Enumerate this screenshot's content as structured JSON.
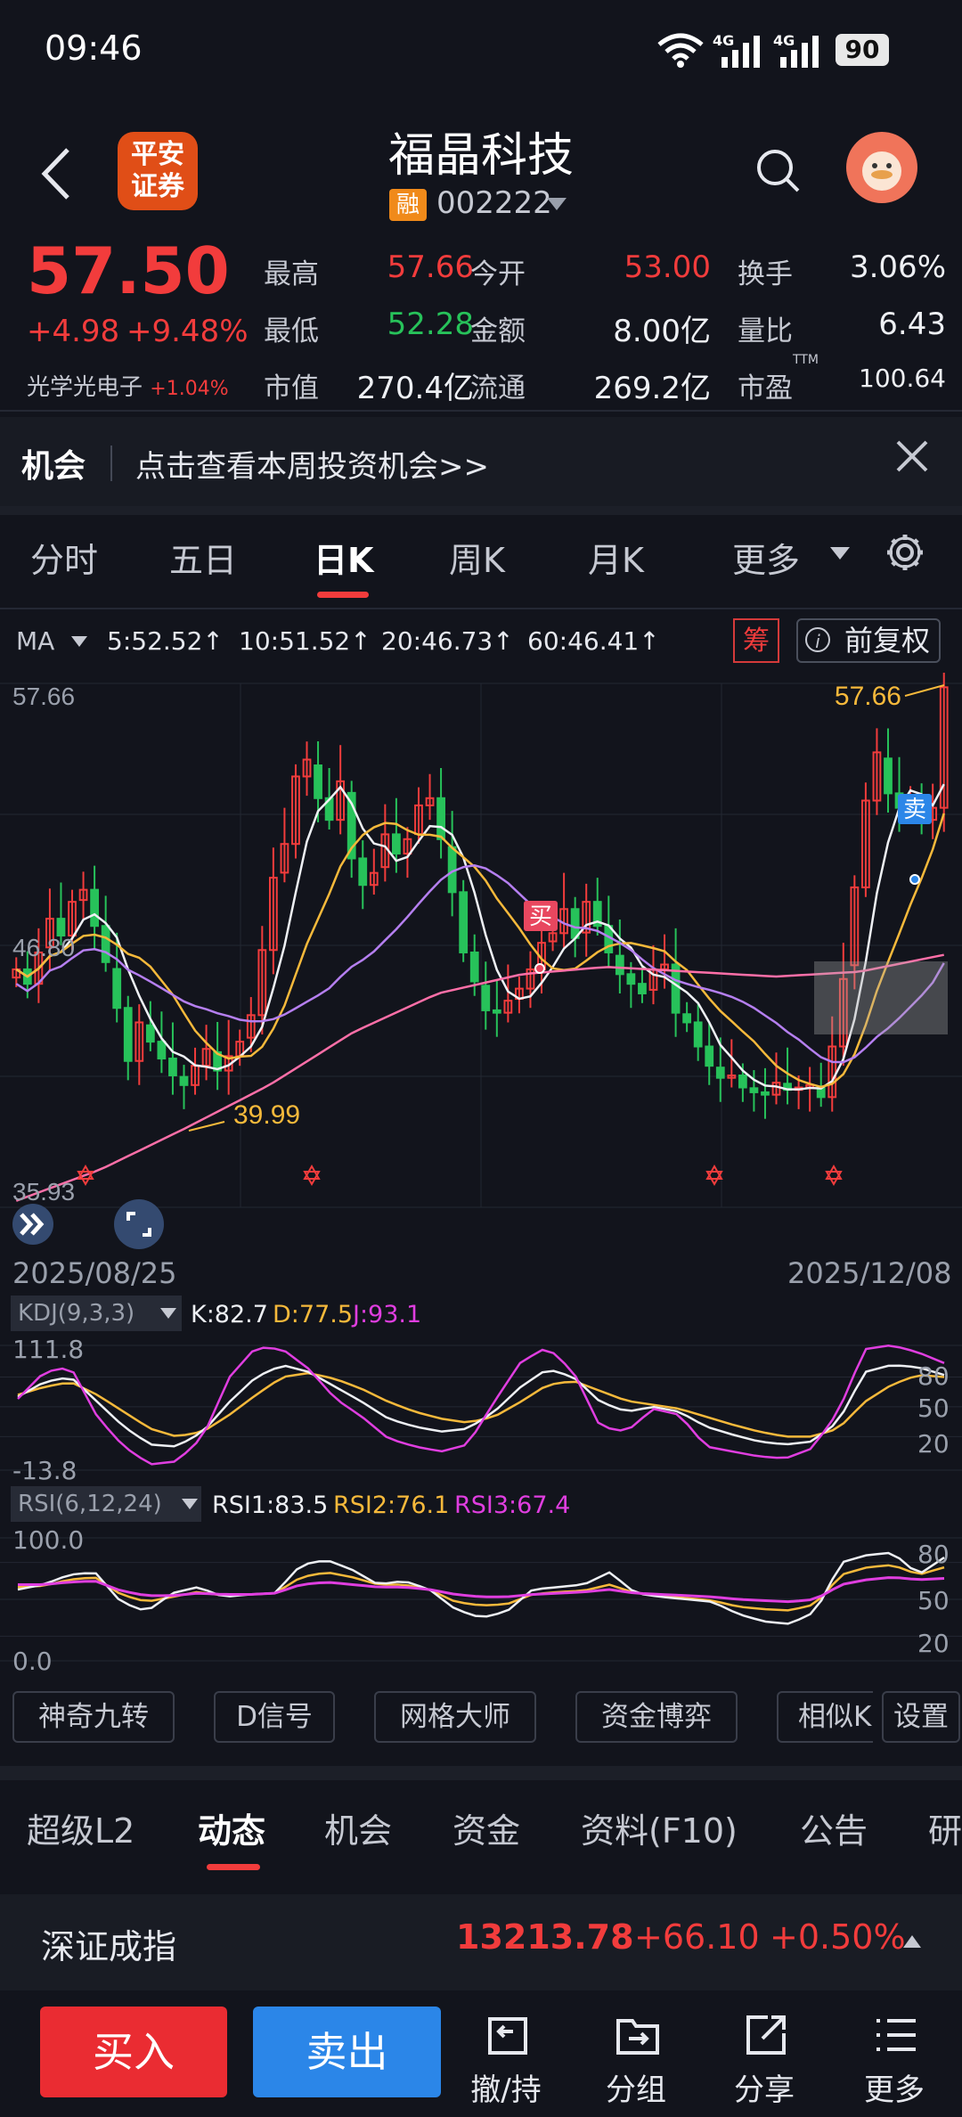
{
  "status_bar": {
    "time": "09:46",
    "network1": "4G",
    "network2": "4G",
    "battery": "90"
  },
  "header": {
    "broker_logo": "平安\n证券",
    "stock_name": "福晶科技",
    "financing_badge": "融",
    "stock_code": "002222"
  },
  "quote": {
    "price": "57.50",
    "change": "+4.98",
    "change_pct": "+9.48%",
    "sector_name": "光学光电子",
    "sector_pct": "+1.04%",
    "fields": [
      {
        "label": "最高",
        "value": "57.66",
        "color": "#f23c3c"
      },
      {
        "label": "今开",
        "value": "53.00",
        "color": "#f23c3c"
      },
      {
        "label": "换手",
        "value": "3.06%",
        "color": "#eef0f4"
      },
      {
        "label": "最低",
        "value": "52.28",
        "color": "#27c25a"
      },
      {
        "label": "金额",
        "value": "8.00亿",
        "color": "#eef0f4"
      },
      {
        "label": "量比",
        "value": "6.43",
        "color": "#eef0f4"
      },
      {
        "label": "市值",
        "value": "270.4亿",
        "color": "#eef0f4"
      },
      {
        "label": "流通",
        "value": "269.2亿",
        "color": "#eef0f4"
      },
      {
        "label": "市盈",
        "value": "100.64",
        "color": "#eef0f4"
      }
    ],
    "pe_suffix": "TTM"
  },
  "opportunity": {
    "title": "机会",
    "text": "点击查看本周投资机会>>"
  },
  "period_tabs": [
    "分时",
    "五日",
    "日K",
    "周K",
    "月K",
    "更多"
  ],
  "active_period": "日K",
  "ma_bar": {
    "label": "MA",
    "items": [
      {
        "text": "5:52.52↑",
        "color": "#eef0f4"
      },
      {
        "text": "10:51.52↑",
        "color": "#f6b93b"
      },
      {
        "text": "20:46.73↑",
        "color": "#b57ff0"
      },
      {
        "text": "60:46.41↑",
        "color": "#ff6fa8"
      }
    ],
    "chou_badge": "筹",
    "fuquan": "前复权"
  },
  "kline": {
    "y_max_label": "57.66",
    "y_mid_label": "46.80",
    "y_min_label": "35.93",
    "high_marker": "57.66",
    "low_marker": "39.99",
    "buy_marker": "买",
    "sell_marker": "卖",
    "start_date": "2025/08/25",
    "end_date": "2025/12/08",
    "y_range": [
      35.93,
      57.66
    ],
    "colors": {
      "up": "#f23c3c",
      "down": "#27c25a",
      "ma5": "#eef0f4",
      "ma10": "#f6b93b",
      "ma20": "#b57ff0",
      "ma60": "#ff6fa8"
    }
  },
  "kdj": {
    "box_label": "KDJ(9,3,3)",
    "k_text": "K:82.7",
    "d_text": "D:77.5",
    "j_text": "J:93.1",
    "y_top": "111.8",
    "y_bottom": "-13.8",
    "levels": [
      "80",
      "50",
      "20"
    ],
    "colors": {
      "k": "#eef0f4",
      "d": "#f6b93b",
      "j": "#e03ee0"
    }
  },
  "rsi": {
    "box_label": "RSI(6,12,24)",
    "rsi1_text": "RSI1:83.5",
    "rsi2_text": "RSI2:76.1",
    "rsi3_text": "RSI3:67.4",
    "y_top": "100.0",
    "y_bottom": "0.0",
    "levels": [
      "80",
      "50",
      "20"
    ],
    "colors": {
      "rsi1": "#eef0f4",
      "rsi2": "#f6b93b",
      "rsi3": "#e03ee0"
    }
  },
  "tool_buttons": [
    "神奇九转",
    "D信号",
    "网格大师",
    "资金博弈",
    "相似K",
    "设置"
  ],
  "bottom_tabs": [
    "超级L2",
    "动态",
    "机会",
    "资金",
    "资料(F10)",
    "公告",
    "研"
  ],
  "active_bottom_tab": "动态",
  "index_bar": {
    "name": "深证成指",
    "value": "13213.78",
    "change": "+66.10",
    "change_pct": "+0.50%"
  },
  "actions": {
    "buy": "买入",
    "sell": "卖出",
    "items": [
      {
        "label": "撤/持",
        "icon": "withdraw-icon"
      },
      {
        "label": "分组",
        "icon": "folder-icon"
      },
      {
        "label": "分享",
        "icon": "share-icon"
      },
      {
        "label": "更多",
        "icon": "menu-icon"
      }
    ]
  }
}
